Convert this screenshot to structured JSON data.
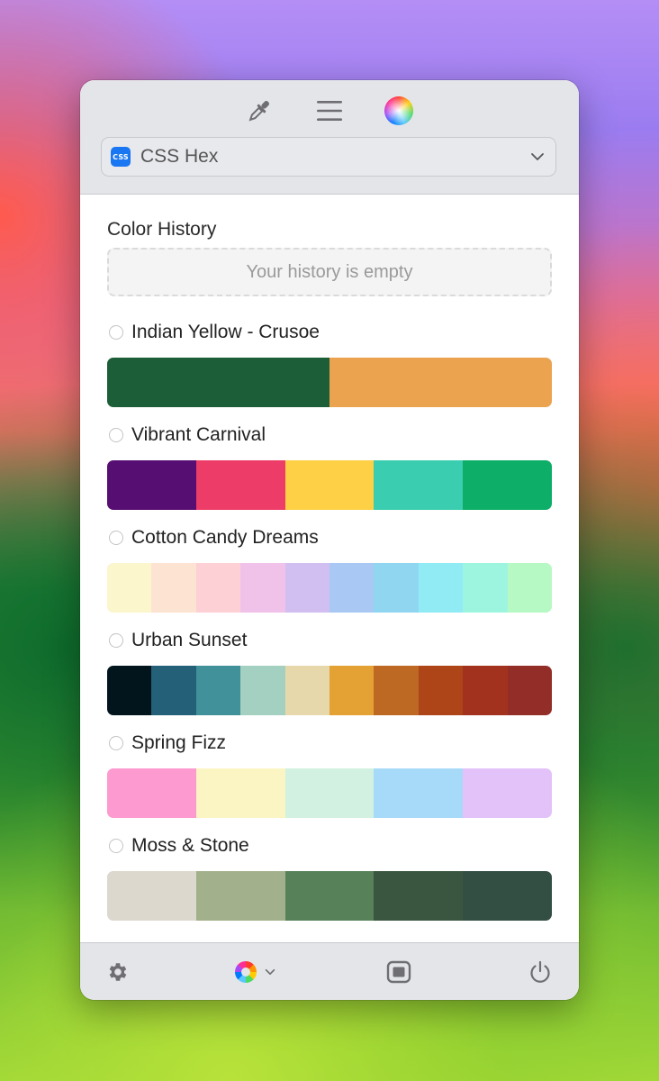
{
  "toolbar": {
    "eyedropper_icon": "eyedropper-icon",
    "menu_icon": "hamburger-menu-icon",
    "color_wheel_icon": "color-wheel-icon"
  },
  "format": {
    "badge": "CSS",
    "label": "CSS Hex",
    "icon": "chevron-down-icon"
  },
  "history": {
    "title": "Color History",
    "empty_text": "Your history is empty"
  },
  "palettes": [
    {
      "name": "Indian Yellow - Crusoe",
      "colors": [
        "#1c5e37",
        "#eba350"
      ]
    },
    {
      "name": "Vibrant Carnival",
      "colors": [
        "#560e72",
        "#ed3c68",
        "#fdd045",
        "#3bcdaf",
        "#0dae68"
      ]
    },
    {
      "name": "Cotton Candy Dreams",
      "colors": [
        "#fbf6cc",
        "#fde3d1",
        "#fdd0d5",
        "#f0c2ea",
        "#d0bff0",
        "#a9c8f3",
        "#90d6f1",
        "#91ebf5",
        "#9ef5df",
        "#b7f9c4"
      ]
    },
    {
      "name": "Urban Sunset",
      "colors": [
        "#02141c",
        "#246178",
        "#41919a",
        "#a3d0c0",
        "#e7d8ab",
        "#e4a235",
        "#bd6923",
        "#ad4519",
        "#a2321d",
        "#922e27"
      ]
    },
    {
      "name": "Spring Fizz",
      "colors": [
        "#fd9ad0",
        "#fbf5c4",
        "#d2f1e1",
        "#a7daf8",
        "#e2c2f8"
      ]
    },
    {
      "name": "Moss & Stone",
      "colors": [
        "#dcd8cd",
        "#a3b08c",
        "#578159",
        "#3b5640",
        "#334e43"
      ]
    }
  ],
  "footer": {
    "settings_icon": "gear-icon",
    "colorspace_icon": "color-wheel-icon",
    "window_icon": "window-icon",
    "power_icon": "power-icon"
  }
}
